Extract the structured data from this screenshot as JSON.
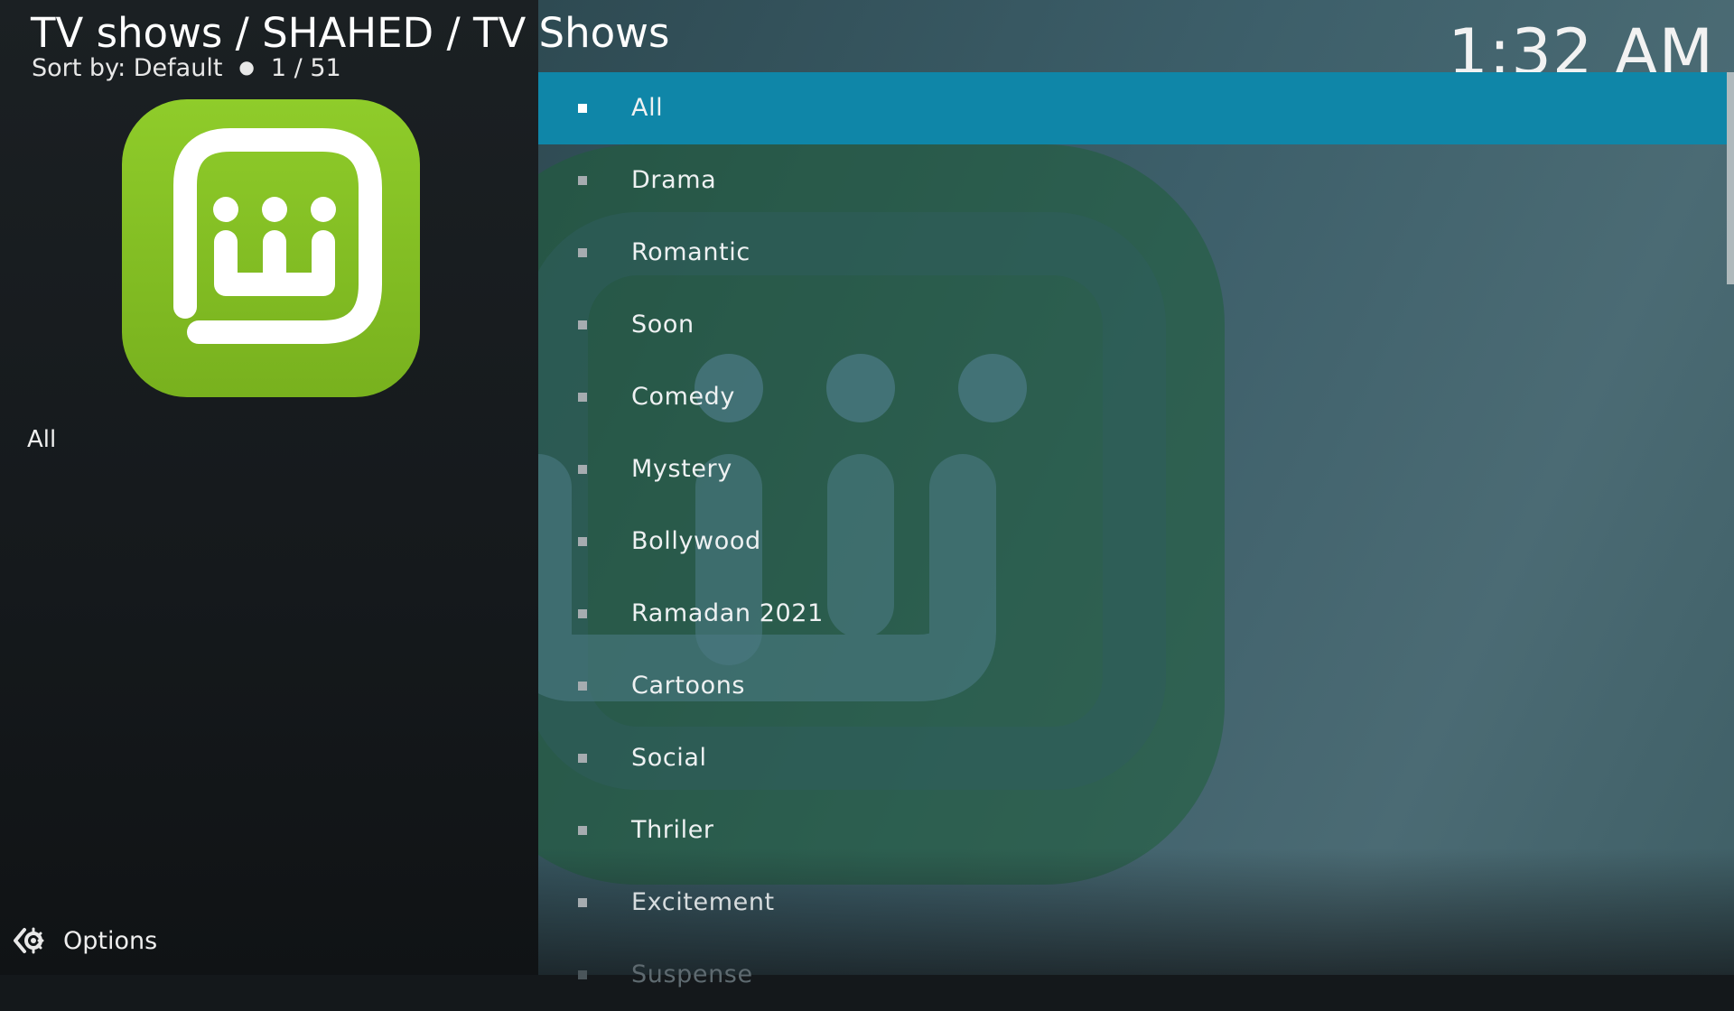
{
  "header": {
    "breadcrumb": "TV shows / SHAHED / TV Shows",
    "sort_label": "Sort by: Default",
    "position": "1 / 51",
    "clock": "1:32 AM"
  },
  "left_panel": {
    "thumbnail_icon": "shahid-logo",
    "selected_item_label": "All",
    "options_icon": "options-gear-icon",
    "options_label": "Options"
  },
  "colors": {
    "accent": "#0f86a8",
    "logo_green": "#84c324"
  },
  "list": {
    "items": [
      {
        "label": "All"
      },
      {
        "label": "Drama"
      },
      {
        "label": "Romantic"
      },
      {
        "label": "Soon"
      },
      {
        "label": "Comedy"
      },
      {
        "label": "Mystery"
      },
      {
        "label": "Bollywood"
      },
      {
        "label": "Ramadan 2021"
      },
      {
        "label": "Cartoons"
      },
      {
        "label": "Social"
      },
      {
        "label": "Thriler"
      },
      {
        "label": "Excitement"
      },
      {
        "label": "Suspense"
      }
    ],
    "selected_index": 0
  }
}
